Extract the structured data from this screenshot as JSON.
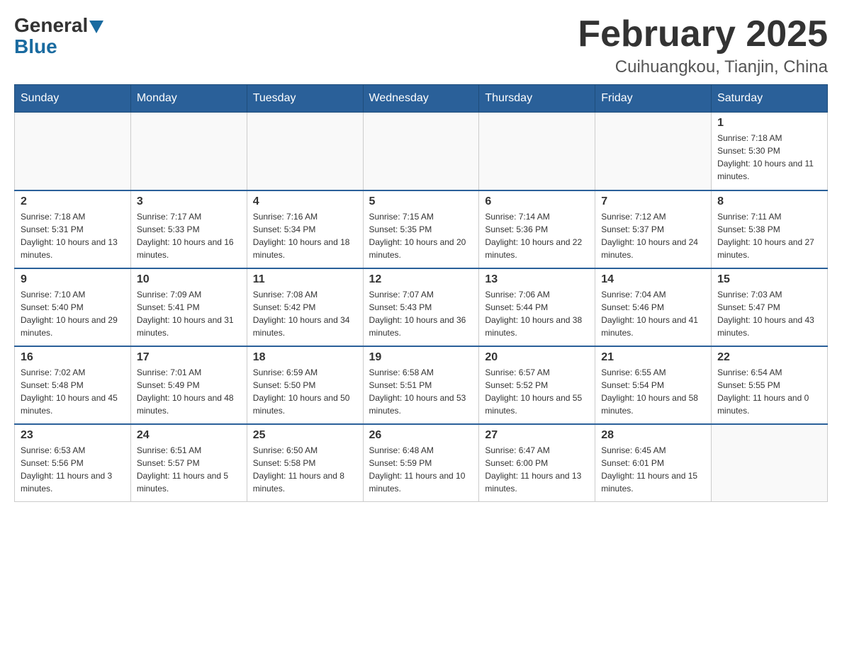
{
  "header": {
    "logo_general": "General",
    "logo_blue": "Blue",
    "month_title": "February 2025",
    "location": "Cuihuangkou, Tianjin, China"
  },
  "days_of_week": [
    "Sunday",
    "Monday",
    "Tuesday",
    "Wednesday",
    "Thursday",
    "Friday",
    "Saturday"
  ],
  "weeks": [
    [
      {
        "day": "",
        "info": ""
      },
      {
        "day": "",
        "info": ""
      },
      {
        "day": "",
        "info": ""
      },
      {
        "day": "",
        "info": ""
      },
      {
        "day": "",
        "info": ""
      },
      {
        "day": "",
        "info": ""
      },
      {
        "day": "1",
        "info": "Sunrise: 7:18 AM\nSunset: 5:30 PM\nDaylight: 10 hours and 11 minutes."
      }
    ],
    [
      {
        "day": "2",
        "info": "Sunrise: 7:18 AM\nSunset: 5:31 PM\nDaylight: 10 hours and 13 minutes."
      },
      {
        "day": "3",
        "info": "Sunrise: 7:17 AM\nSunset: 5:33 PM\nDaylight: 10 hours and 16 minutes."
      },
      {
        "day": "4",
        "info": "Sunrise: 7:16 AM\nSunset: 5:34 PM\nDaylight: 10 hours and 18 minutes."
      },
      {
        "day": "5",
        "info": "Sunrise: 7:15 AM\nSunset: 5:35 PM\nDaylight: 10 hours and 20 minutes."
      },
      {
        "day": "6",
        "info": "Sunrise: 7:14 AM\nSunset: 5:36 PM\nDaylight: 10 hours and 22 minutes."
      },
      {
        "day": "7",
        "info": "Sunrise: 7:12 AM\nSunset: 5:37 PM\nDaylight: 10 hours and 24 minutes."
      },
      {
        "day": "8",
        "info": "Sunrise: 7:11 AM\nSunset: 5:38 PM\nDaylight: 10 hours and 27 minutes."
      }
    ],
    [
      {
        "day": "9",
        "info": "Sunrise: 7:10 AM\nSunset: 5:40 PM\nDaylight: 10 hours and 29 minutes."
      },
      {
        "day": "10",
        "info": "Sunrise: 7:09 AM\nSunset: 5:41 PM\nDaylight: 10 hours and 31 minutes."
      },
      {
        "day": "11",
        "info": "Sunrise: 7:08 AM\nSunset: 5:42 PM\nDaylight: 10 hours and 34 minutes."
      },
      {
        "day": "12",
        "info": "Sunrise: 7:07 AM\nSunset: 5:43 PM\nDaylight: 10 hours and 36 minutes."
      },
      {
        "day": "13",
        "info": "Sunrise: 7:06 AM\nSunset: 5:44 PM\nDaylight: 10 hours and 38 minutes."
      },
      {
        "day": "14",
        "info": "Sunrise: 7:04 AM\nSunset: 5:46 PM\nDaylight: 10 hours and 41 minutes."
      },
      {
        "day": "15",
        "info": "Sunrise: 7:03 AM\nSunset: 5:47 PM\nDaylight: 10 hours and 43 minutes."
      }
    ],
    [
      {
        "day": "16",
        "info": "Sunrise: 7:02 AM\nSunset: 5:48 PM\nDaylight: 10 hours and 45 minutes."
      },
      {
        "day": "17",
        "info": "Sunrise: 7:01 AM\nSunset: 5:49 PM\nDaylight: 10 hours and 48 minutes."
      },
      {
        "day": "18",
        "info": "Sunrise: 6:59 AM\nSunset: 5:50 PM\nDaylight: 10 hours and 50 minutes."
      },
      {
        "day": "19",
        "info": "Sunrise: 6:58 AM\nSunset: 5:51 PM\nDaylight: 10 hours and 53 minutes."
      },
      {
        "day": "20",
        "info": "Sunrise: 6:57 AM\nSunset: 5:52 PM\nDaylight: 10 hours and 55 minutes."
      },
      {
        "day": "21",
        "info": "Sunrise: 6:55 AM\nSunset: 5:54 PM\nDaylight: 10 hours and 58 minutes."
      },
      {
        "day": "22",
        "info": "Sunrise: 6:54 AM\nSunset: 5:55 PM\nDaylight: 11 hours and 0 minutes."
      }
    ],
    [
      {
        "day": "23",
        "info": "Sunrise: 6:53 AM\nSunset: 5:56 PM\nDaylight: 11 hours and 3 minutes."
      },
      {
        "day": "24",
        "info": "Sunrise: 6:51 AM\nSunset: 5:57 PM\nDaylight: 11 hours and 5 minutes."
      },
      {
        "day": "25",
        "info": "Sunrise: 6:50 AM\nSunset: 5:58 PM\nDaylight: 11 hours and 8 minutes."
      },
      {
        "day": "26",
        "info": "Sunrise: 6:48 AM\nSunset: 5:59 PM\nDaylight: 11 hours and 10 minutes."
      },
      {
        "day": "27",
        "info": "Sunrise: 6:47 AM\nSunset: 6:00 PM\nDaylight: 11 hours and 13 minutes."
      },
      {
        "day": "28",
        "info": "Sunrise: 6:45 AM\nSunset: 6:01 PM\nDaylight: 11 hours and 15 minutes."
      },
      {
        "day": "",
        "info": ""
      }
    ]
  ]
}
